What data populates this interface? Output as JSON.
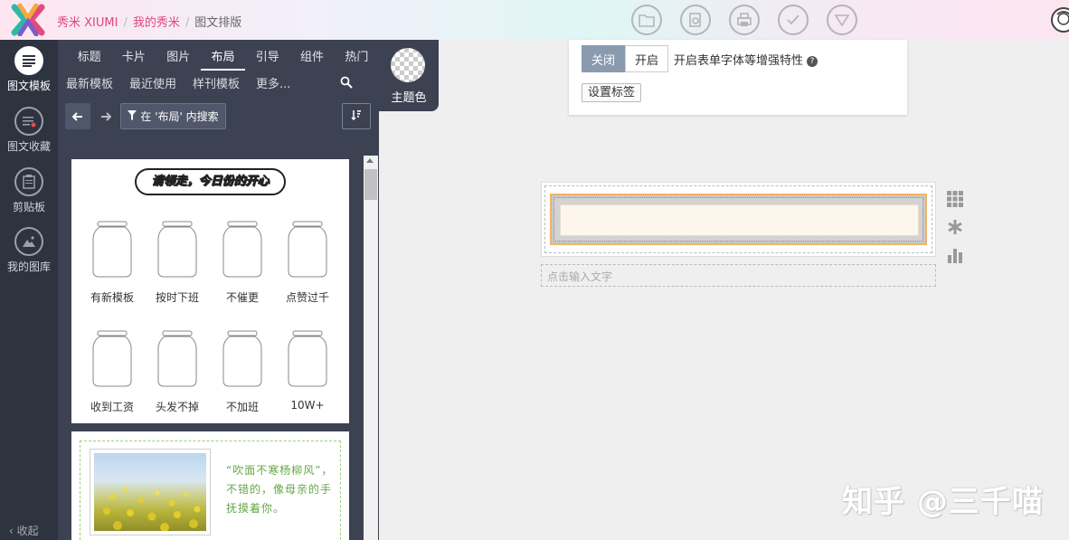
{
  "breadcrumb": {
    "items": [
      "秀米 XIUMI",
      "我的秀米",
      "图文排版"
    ],
    "separator": "/"
  },
  "toolbar": {
    "icons": [
      "folder-icon",
      "preview-icon",
      "print-icon",
      "check-icon",
      "triangle-down-icon"
    ]
  },
  "rail": {
    "items": [
      {
        "label": "图文模板",
        "icon": "list-icon",
        "active": true
      },
      {
        "label": "图文收藏",
        "icon": "favorite-list-icon",
        "active": false
      },
      {
        "label": "剪贴板",
        "icon": "clipboard-icon",
        "active": false
      },
      {
        "label": "我的图库",
        "icon": "image-library-icon",
        "active": false
      }
    ],
    "collapse_label": "收起"
  },
  "panel": {
    "tabs": [
      "标题",
      "卡片",
      "图片",
      "布局",
      "引导",
      "组件",
      "热门"
    ],
    "active_tab": "布局",
    "subtabs": [
      "最新模板",
      "最近使用",
      "样刊模板",
      "更多..."
    ],
    "search_chip": "在 '布局' 内搜索",
    "theme_label": "主题色"
  },
  "card1": {
    "title": "请领走，今日份的开心",
    "jars": [
      "有新模板",
      "按时下班",
      "不催更",
      "点赞过千",
      "收到工资",
      "头发不掉",
      "不加班",
      "10W+"
    ]
  },
  "card2": {
    "text": "“吹面不寒杨柳风”，不错的，像母亲的手抚摸着你。"
  },
  "editor": {
    "toggle_off": "关闭",
    "toggle_on": "开启",
    "toggle_label": "开启表单字体等增强特性",
    "help_glyph": "?",
    "tag_button": "设置标签",
    "text_placeholder": "点击输入文字"
  },
  "watermark": "知乎 @三千喵",
  "colors": {
    "accent_pink": "#e0477b",
    "panel_bg": "#3c4252",
    "rail_bg": "#2e3340",
    "toggle_active": "#8a9bb0",
    "quote_green": "#65a844"
  }
}
